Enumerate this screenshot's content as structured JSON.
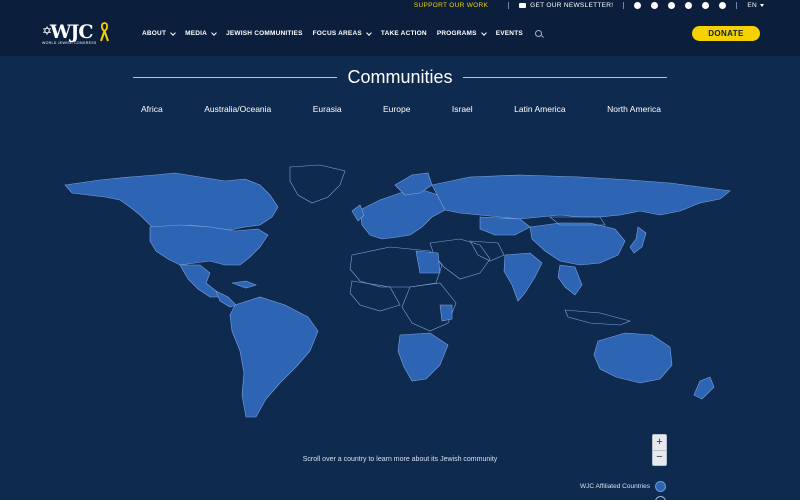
{
  "topbar": {
    "support_label": "SUPPORT OUR WORK",
    "newsletter_label": "GET OUR NEWSLETTER!",
    "language": "EN",
    "social_icons": [
      "youtube-icon",
      "twitter-icon",
      "instagram-icon",
      "facebook-icon",
      "linkedin-icon",
      "tiktok-icon"
    ]
  },
  "logo": {
    "text": "WJC",
    "subtitle": "WORLD JEWISH CONGRESS"
  },
  "nav": {
    "items": [
      {
        "label": "ABOUT",
        "dropdown": true
      },
      {
        "label": "MEDIA",
        "dropdown": true
      },
      {
        "label": "JEWISH COMMUNITIES",
        "dropdown": false
      },
      {
        "label": "FOCUS AREAS",
        "dropdown": true
      },
      {
        "label": "TAKE ACTION",
        "dropdown": false
      },
      {
        "label": "PROGRAMS",
        "dropdown": true
      },
      {
        "label": "EVENTS",
        "dropdown": false
      }
    ],
    "donate_label": "DONATE"
  },
  "page": {
    "title": "Communities",
    "regions": [
      "Africa",
      "Australia/Oceania",
      "Eurasia",
      "Europe",
      "Israel",
      "Latin America",
      "North America"
    ],
    "hint": "Scroll over a country to learn more about its Jewish community"
  },
  "map_controls": {
    "zoom_in": "+",
    "zoom_out": "−"
  },
  "legend": {
    "affiliated_label": "WJC Affiliated Countries"
  },
  "colors": {
    "background": "#0f2a4f",
    "nav_background": "#0b1f3c",
    "accent_yellow": "#f5d100",
    "affiliated_blue": "#2e64b4"
  }
}
